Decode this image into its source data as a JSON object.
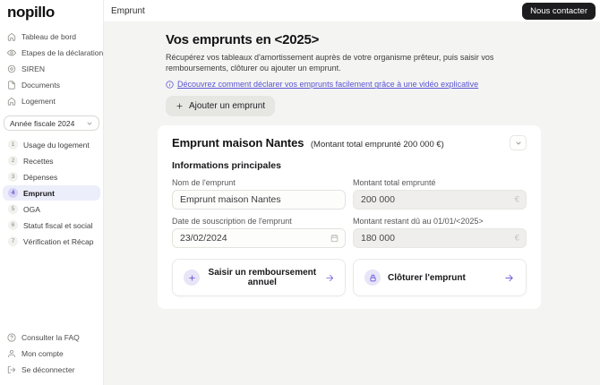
{
  "brand": "nopillo",
  "colors": {
    "accent": "#5a54d4",
    "accent_soft": "#e8e5f8",
    "active_bg": "#edeefb",
    "dark_btn": "#1d1d1f"
  },
  "topbar": {
    "title": "Emprunt",
    "contact_button": "Nous contacter"
  },
  "sidebar": {
    "nav": [
      {
        "icon": "dashboard-home-icon",
        "label": "Tableau de bord"
      },
      {
        "icon": "eye-icon",
        "label": "Etapes de la déclaration"
      },
      {
        "icon": "target-icon",
        "label": "SIREN"
      },
      {
        "icon": "document-icon",
        "label": "Documents"
      },
      {
        "icon": "house-icon",
        "label": "Logement"
      }
    ],
    "fiscal_year": "Année fiscale 2024",
    "steps": [
      {
        "num": "1",
        "label": "Usage du logement"
      },
      {
        "num": "2",
        "label": "Recettes"
      },
      {
        "num": "3",
        "label": "Dépenses"
      },
      {
        "num": "4",
        "label": "Emprunt"
      },
      {
        "num": "5",
        "label": "OGA"
      },
      {
        "num": "6",
        "label": "Statut fiscal et social"
      },
      {
        "num": "7",
        "label": "Vérification et Récap"
      }
    ],
    "footer": [
      {
        "icon": "question-icon",
        "label": "Consulter la FAQ"
      },
      {
        "icon": "user-icon",
        "label": "Mon compte"
      },
      {
        "icon": "logout-icon",
        "label": "Se déconnecter"
      }
    ]
  },
  "main": {
    "title": "Vos emprunts en <2025>",
    "subtitle": "Récupérez vos tableaux d'amortissement auprès de votre organisme prêteur, puis saisir vos remboursements, clôturer ou ajouter un emprunt.",
    "video_link": "Découvrez comment déclarer vos emprunts facilement grâce à une vidéo explicative",
    "add_button": "Ajouter un emprunt",
    "card": {
      "title": "Emprunt maison Nantes",
      "subtitle": "(Montant total emprunté 200 000 €)",
      "section_title": "Informations principales",
      "fields": {
        "name": {
          "label": "Nom de l'emprunt",
          "value": "Emprunt maison Nantes"
        },
        "total": {
          "label": "Montant total emprunté",
          "value": "200 000",
          "suffix": "€"
        },
        "date": {
          "label": "Date de souscription de l'emprunt",
          "value": "23/02/2024"
        },
        "remaining": {
          "label": "Montant restant dû au 01/01/<2025>",
          "value": "180 000",
          "suffix": "€"
        }
      },
      "actions": [
        {
          "icon": "plus-icon",
          "label": "Saisir un remboursement annuel"
        },
        {
          "icon": "lock-icon",
          "label": "Clôturer l'emprunt"
        }
      ]
    }
  }
}
